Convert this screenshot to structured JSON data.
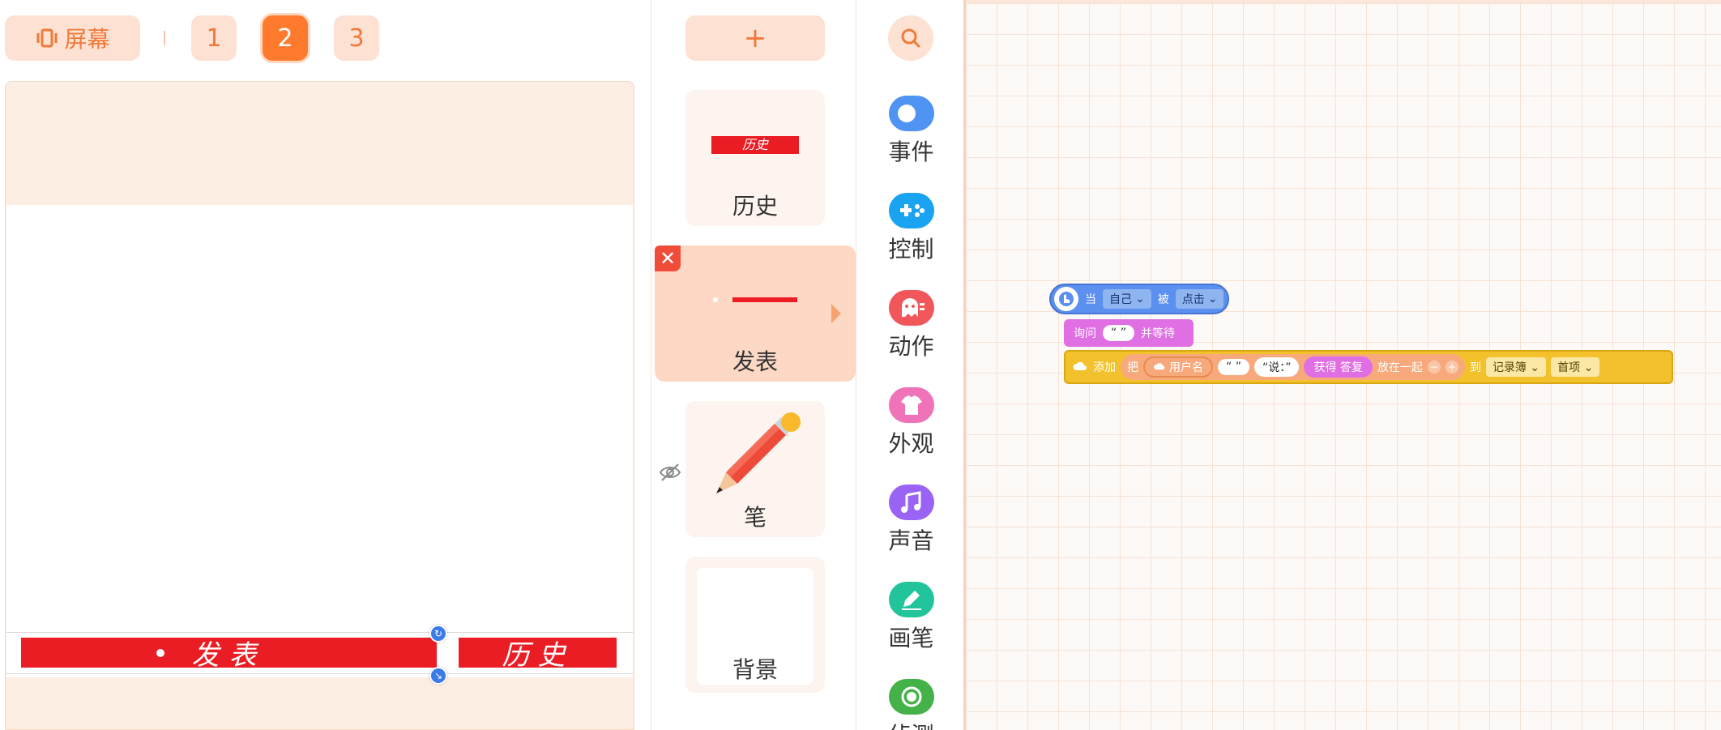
{
  "topbar": {
    "screen_label": "屏幕",
    "pages": [
      "1",
      "2",
      "3"
    ],
    "active_page": "2"
  },
  "stage": {
    "post_bar_text": "发表",
    "history_bar_text": "历史"
  },
  "sprites": {
    "add_label": "+",
    "items": [
      {
        "name": "历史",
        "thumb_text": "历史"
      },
      {
        "name": "发表",
        "thumb_text": ""
      },
      {
        "name": "笔"
      },
      {
        "name": "背景"
      }
    ]
  },
  "categories": [
    {
      "name": "事件",
      "icon": "toggle-icon",
      "color": "#4f93f3"
    },
    {
      "name": "控制",
      "icon": "gamepad-icon",
      "color": "#1aa3f0"
    },
    {
      "name": "动作",
      "icon": "ghost-icon",
      "color": "#f0565a"
    },
    {
      "name": "外观",
      "icon": "shirt-icon",
      "color": "#f072b8"
    },
    {
      "name": "声音",
      "icon": "music-icon",
      "color": "#9a63f3"
    },
    {
      "name": "画笔",
      "icon": "pen-icon",
      "color": "#22c59b"
    },
    {
      "name": "侦测",
      "icon": "target-icon",
      "color": "#45b249"
    }
  ],
  "blocks": {
    "event": {
      "when": "当",
      "target": "自己",
      "is": "被",
      "action": "点击"
    },
    "ask": {
      "ask": "询问",
      "quote": "“ ”",
      "wait": "并等待"
    },
    "add": {
      "add": "添加",
      "put": "把",
      "username": "用户名",
      "quote1": "“ ”",
      "says": "“说：”",
      "answer": "获得 答复",
      "join": "放在一起",
      "to": "到",
      "list": "记录簿",
      "pos": "首项"
    }
  },
  "colors": {
    "accent": "#ff7a2d",
    "stage_bg": "#fdeee4",
    "red_bar": "#ea1c24"
  }
}
